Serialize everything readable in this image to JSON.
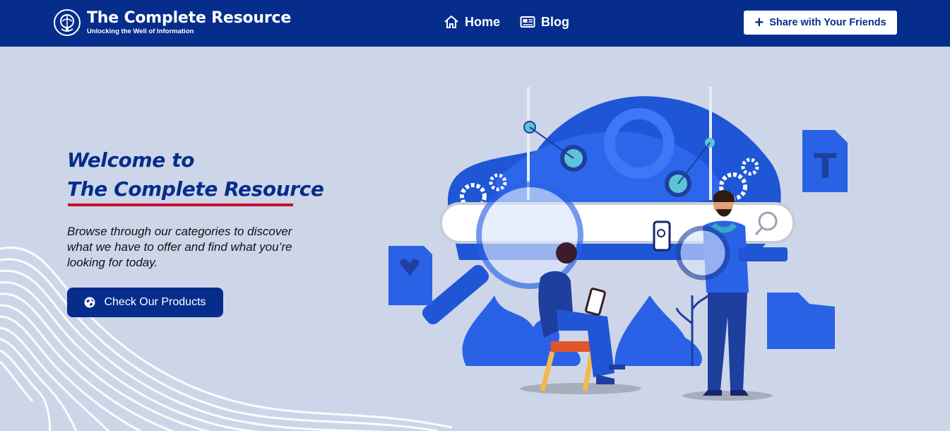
{
  "header": {
    "brand_title": "The Complete Resource",
    "brand_tagline": "Unlocking the Well of Information",
    "logo_icon": "globe-logo-icon",
    "nav": [
      {
        "label": "Home",
        "icon": "home-icon"
      },
      {
        "label": "Blog",
        "icon": "newspaper-icon"
      }
    ],
    "share_label": "Share with Your Friends",
    "share_icon": "plus-icon"
  },
  "hero": {
    "title_line1": "Welcome to",
    "title_line2": "The Complete Resource",
    "description": "Browse through our categories to discover what we have to offer and find what you’re looking for today.",
    "cta_label": "Check Our Products",
    "cta_icon": "globe-icon"
  },
  "colors": {
    "brand_navy": "#062d8c",
    "background": "#cdd6e9",
    "accent_red": "#c8102e",
    "illustration_blue": "#2a62e6"
  }
}
